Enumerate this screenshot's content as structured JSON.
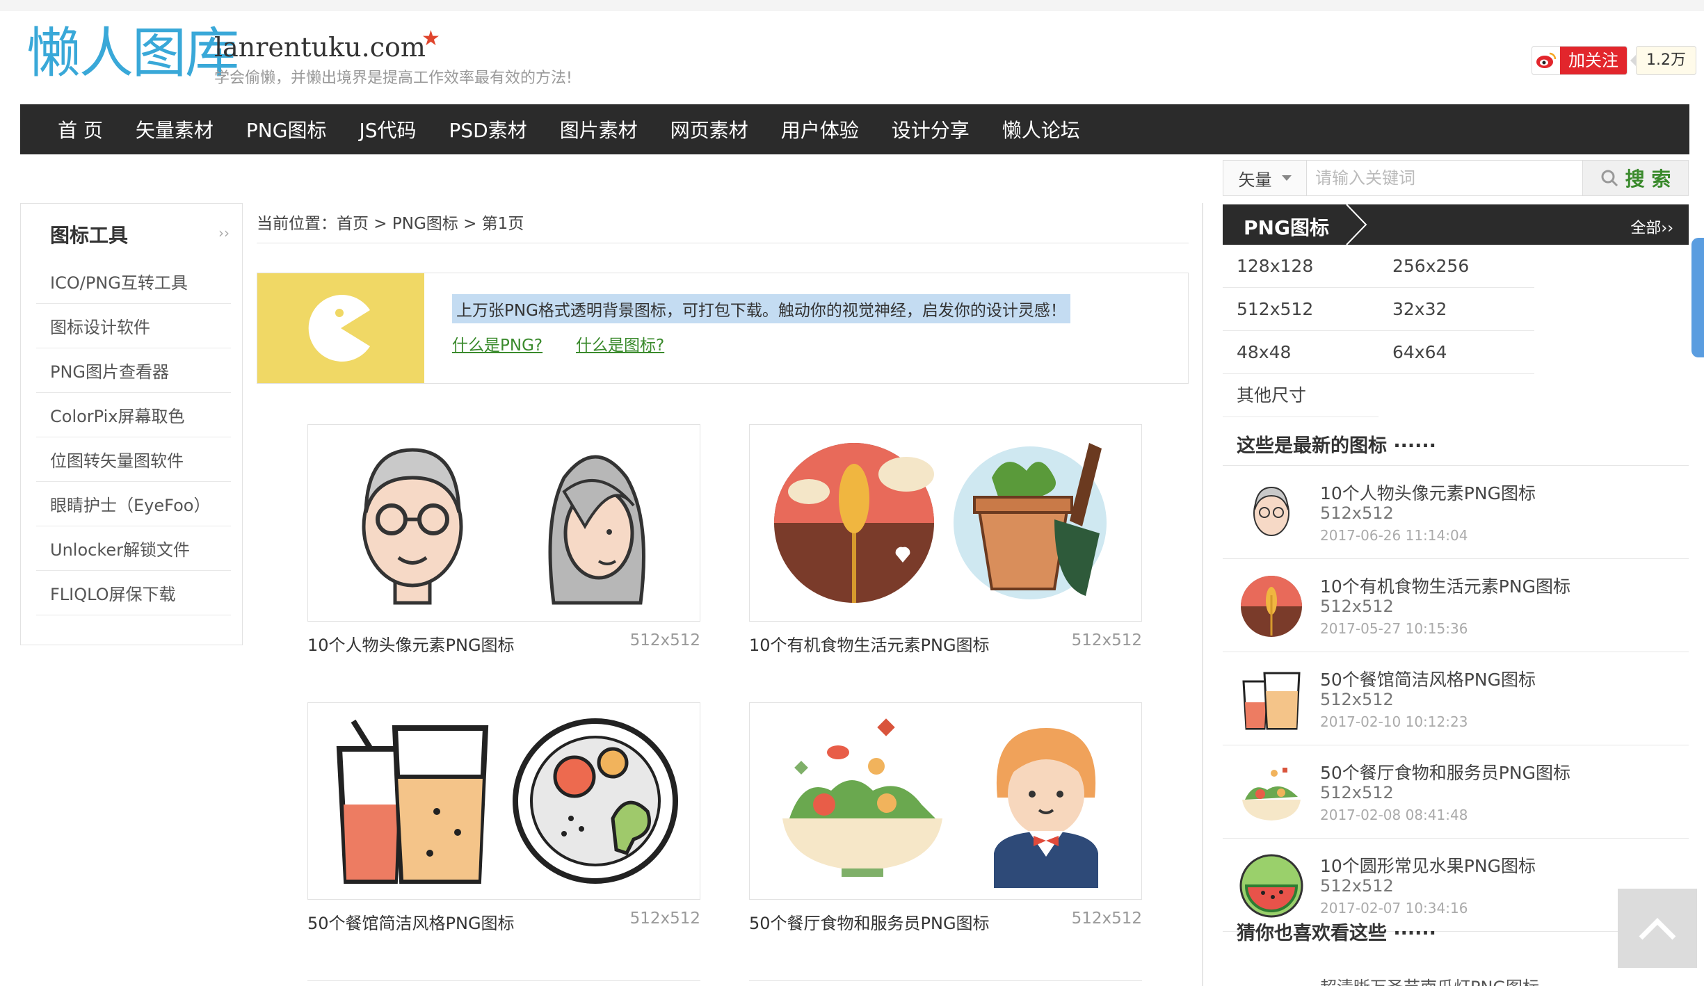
{
  "header": {
    "logo_cn": "懒人图库",
    "logo_en": "lanrentuku.com",
    "slogan": "学会偷懒，并懒出境界是提高工作效率最有效的方法!",
    "follow_label": "加关注",
    "follow_count": "1.2万"
  },
  "nav": [
    "首 页",
    "矢量素材",
    "PNG图标",
    "JS代码",
    "PSD素材",
    "图片素材",
    "网页素材",
    "用户体验",
    "设计分享",
    "懒人论坛"
  ],
  "search": {
    "type": "矢量",
    "placeholder": "请输入关键词",
    "button": "搜 索"
  },
  "sidebar": {
    "title": "图标工具",
    "more": "››",
    "items": [
      "ICO/PNG互转工具",
      "图标设计软件",
      "PNG图片查看器",
      "ColorPix屏幕取色",
      "位图转矢量图软件",
      "眼睛护士（EyeFoo）",
      "Unlocker解锁文件",
      "FLIQLO屏保下载"
    ]
  },
  "breadcrumb": "当前位置：首页 > PNG图标 > 第1页",
  "banner": {
    "text": "上万张PNG格式透明背景图标，可打包下载。触动你的视觉神经，启发你的设计灵感！",
    "link1": "什么是PNG?",
    "link2": "什么是图标?"
  },
  "cards": [
    {
      "title": "10个人物头像元素PNG图标",
      "size": "512x512"
    },
    {
      "title": "10个有机食物生活元素PNG图标",
      "size": "512x512"
    },
    {
      "title": "50个餐馆简洁风格PNG图标",
      "size": "512x512"
    },
    {
      "title": "50个餐厅食物和服务员PNG图标",
      "size": "512x512"
    }
  ],
  "right": {
    "png_title": "PNG图标",
    "png_more": "全部››",
    "sizes": [
      "128x128",
      "256x256",
      "512x512",
      "32x32",
      "48x48",
      "64x64",
      "其他尺寸"
    ],
    "latest_title": "这些是最新的图标 ······",
    "latest": [
      {
        "name": "10个人物头像元素PNG图标",
        "size": "512x512",
        "date": "2017-06-26 11:14:04"
      },
      {
        "name": "10个有机食物生活元素PNG图标",
        "size": "512x512",
        "date": "2017-05-27 10:15:36"
      },
      {
        "name": "50个餐馆简洁风格PNG图标",
        "size": "512x512",
        "date": "2017-02-10 10:12:23"
      },
      {
        "name": "50个餐厅食物和服务员PNG图标",
        "size": "512x512",
        "date": "2017-02-08 08:41:48"
      },
      {
        "name": "10个圆形常见水果PNG图标",
        "size": "512x512",
        "date": "2017-02-07 10:34:16"
      }
    ],
    "more_title": "猜你也喜欢看这些 ······",
    "peek": "超清晰万圣节南瓜灯PNG图标"
  },
  "colors": {
    "nav_bg": "#2b2b2b",
    "accent_green": "#3a8a2c",
    "logo_blue": "#39a8d8",
    "follow_red": "#e2262c",
    "banner_yellow": "#f0d865"
  }
}
